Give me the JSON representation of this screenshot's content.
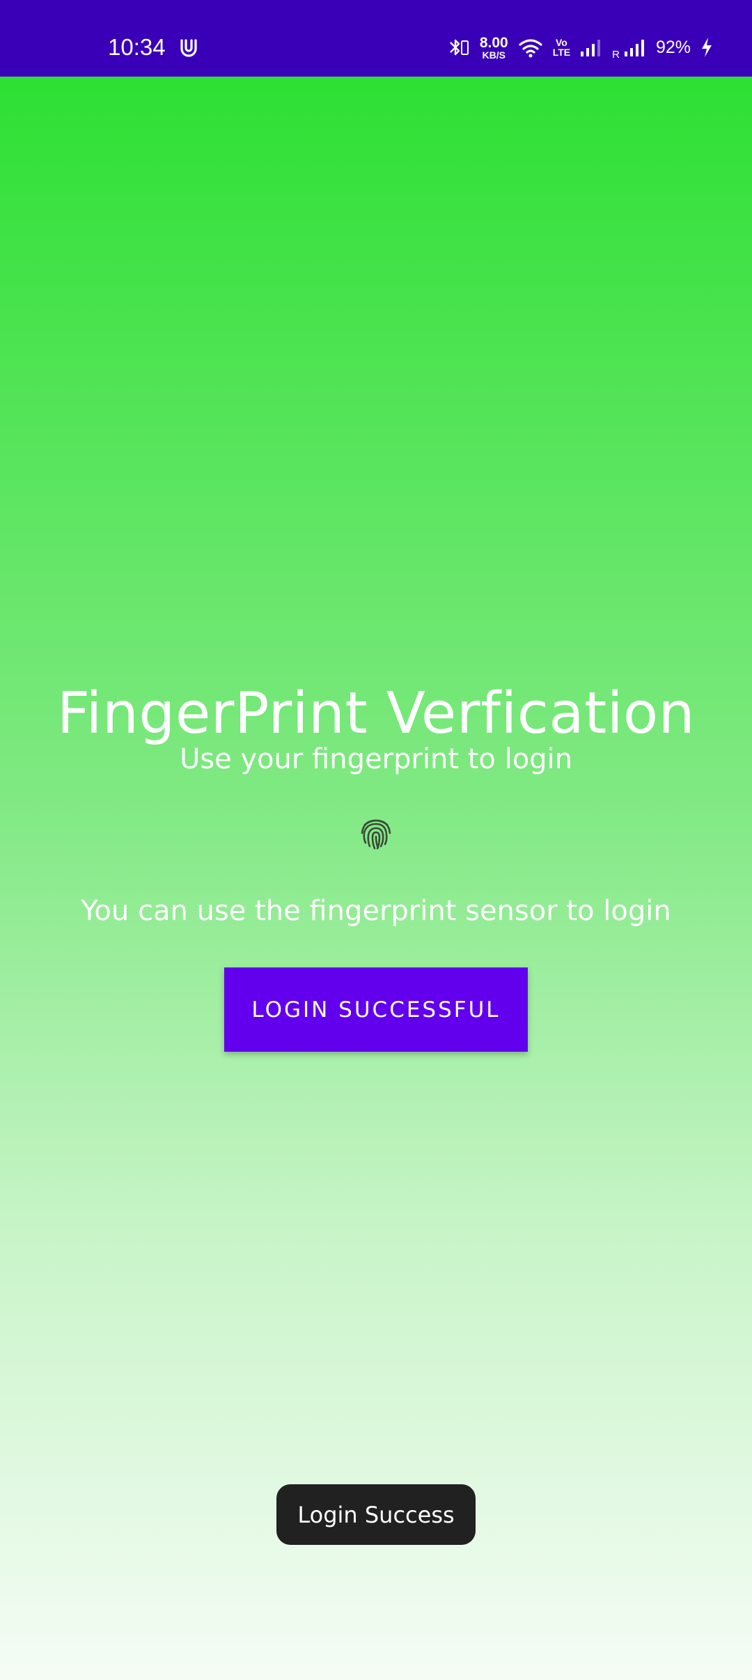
{
  "status_bar": {
    "time": "10:34",
    "net_speed_value": "8.00",
    "net_speed_unit": "KB/S",
    "volte_top": "Vo",
    "volte_bottom": "LTE",
    "roaming": "R",
    "battery": "92%",
    "icons": [
      "u-app-icon",
      "bluetooth-icon",
      "wifi-icon",
      "signal-icon",
      "signal-roaming-icon",
      "charging-icon"
    ],
    "background": "#3a00b8"
  },
  "main": {
    "title": "FingerPrint Verfication",
    "subtitle": "Use your fingerprint to login",
    "icon": "fingerprint-icon",
    "hint": "You can use the fingerprint sensor to login",
    "button_label": "LOGIN SUCCESSFUL",
    "button_color": "#6200ee",
    "gradient_top": "#2de033",
    "gradient_bottom": "#f5fcf5"
  },
  "toast": {
    "message": "Login Success"
  }
}
